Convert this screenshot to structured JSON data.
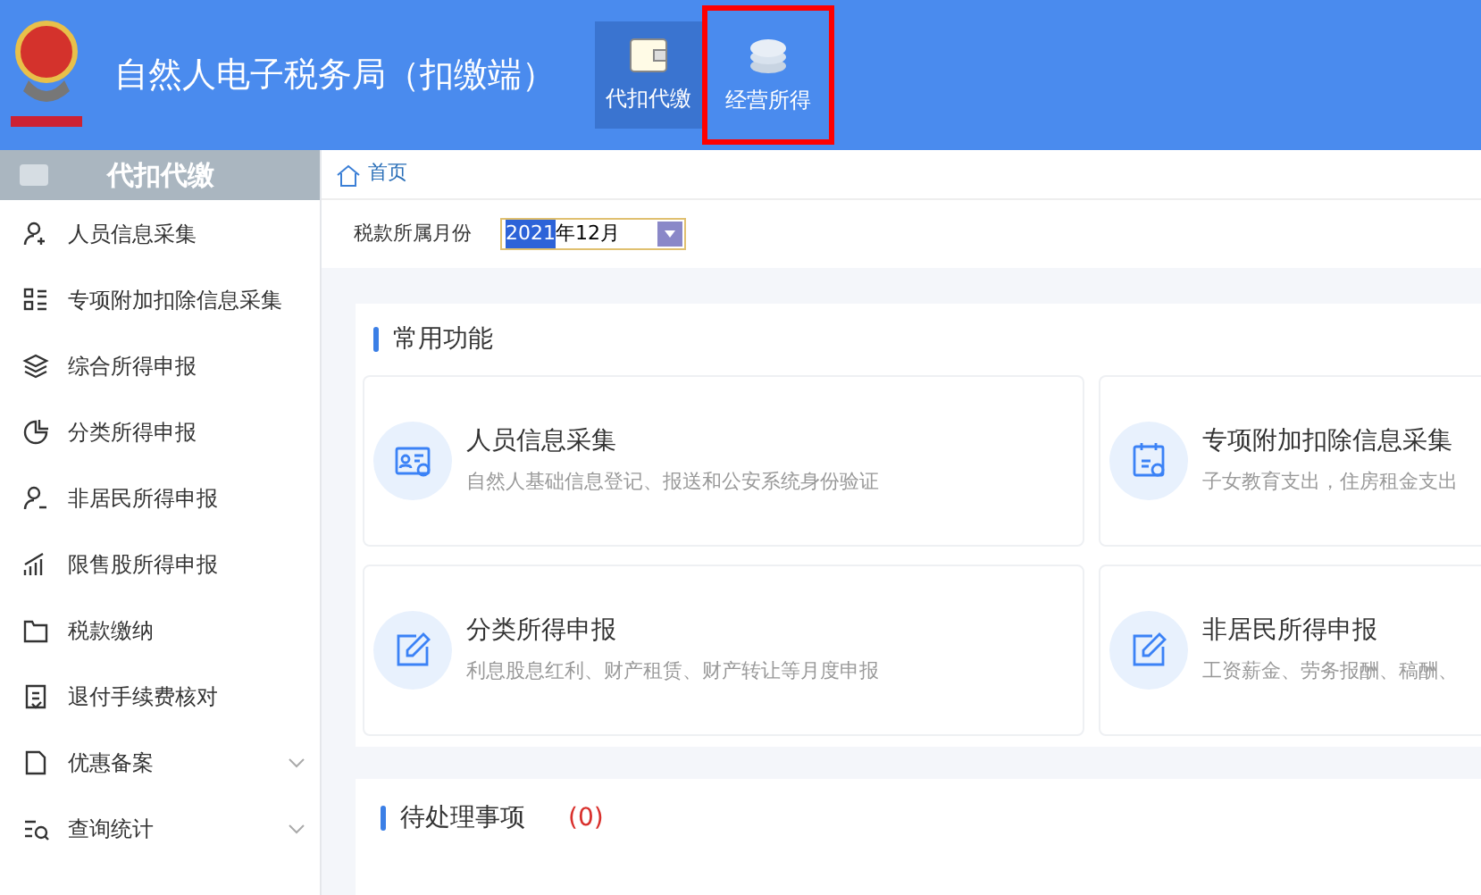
{
  "header": {
    "title": "自然人电子税务局（扣缴端）",
    "nav": [
      {
        "label": "代扣代缴",
        "selected": true,
        "outlined": false,
        "kind": "wallet"
      },
      {
        "label": "经营所得",
        "selected": false,
        "outlined": true,
        "kind": "coins"
      }
    ]
  },
  "sidebar": {
    "title": "代扣代缴",
    "items": [
      {
        "label": "人员信息采集",
        "kind": "user-add",
        "expandable": false
      },
      {
        "label": "专项附加扣除信息采集",
        "kind": "list",
        "expandable": false
      },
      {
        "label": "综合所得申报",
        "kind": "layers",
        "expandable": false
      },
      {
        "label": "分类所得申报",
        "kind": "pie",
        "expandable": false
      },
      {
        "label": "非居民所得申报",
        "kind": "user",
        "expandable": false
      },
      {
        "label": "限售股所得申报",
        "kind": "bars",
        "expandable": false
      },
      {
        "label": "税款缴纳",
        "kind": "folder",
        "expandable": false
      },
      {
        "label": "退付手续费核对",
        "kind": "doc-check",
        "expandable": false
      },
      {
        "label": "优惠备案",
        "kind": "doc",
        "expandable": true
      },
      {
        "label": "查询统计",
        "kind": "search-list",
        "expandable": true
      }
    ]
  },
  "breadcrumb": {
    "label": "首页"
  },
  "filter": {
    "label": "税款所属月份",
    "selected_text": "2021",
    "text": "年12月"
  },
  "common_functions": {
    "title": "常用功能",
    "cards": [
      {
        "title": "人员信息采集",
        "description": "自然人基础信息登记、报送和公安系统身份验证",
        "kind": "id-card"
      },
      {
        "title": "专项附加扣除信息采集",
        "description": "子女教育支出，住房租金支出",
        "kind": "calendar"
      },
      {
        "title": "分类所得申报",
        "description": "利息股息红利、财产租赁、财产转让等月度申报",
        "kind": "edit"
      },
      {
        "title": "非居民所得申报",
        "description": "工资薪金、劳务报酬、稿酬、",
        "kind": "edit"
      }
    ]
  },
  "pending": {
    "title": "待处理事项",
    "count": "(0)"
  }
}
